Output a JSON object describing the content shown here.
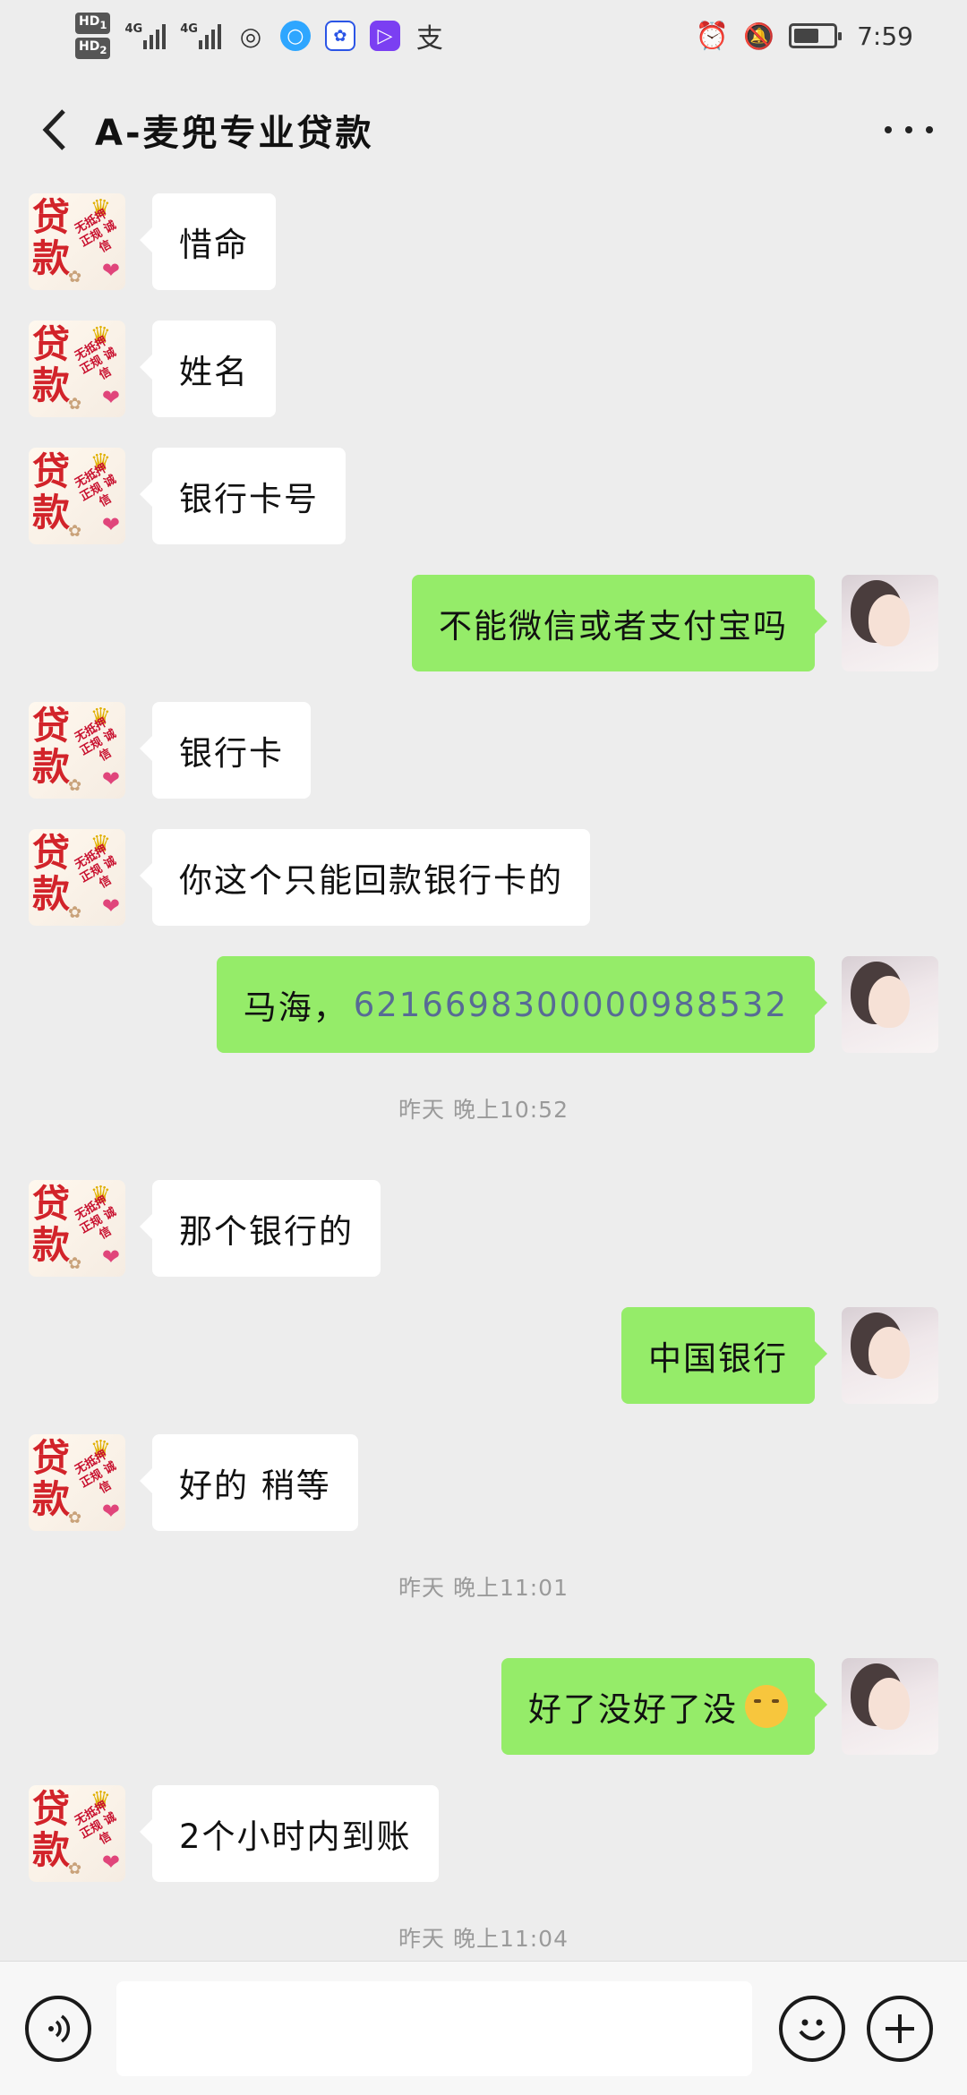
{
  "status_bar": {
    "hd_labels": [
      "HD",
      "HD"
    ],
    "hd_sub": [
      "1",
      "2"
    ],
    "network_labels": [
      "4G",
      "4G"
    ],
    "app_icons": [
      "weibo-icon",
      "browser-icon",
      "baidu-icon",
      "video-icon",
      "alipay-icon"
    ],
    "alipay_glyph": "支",
    "time": "7:59",
    "status_icons": [
      "alarm-icon",
      "mute-icon",
      "battery-icon"
    ],
    "battery_level": 0.65
  },
  "header": {
    "title": "A-麦兜专业贷款",
    "back_icon": "chevron-left-icon",
    "more_icon": "more-icon"
  },
  "contact_avatar": {
    "big_text": [
      "贷",
      "款"
    ],
    "small_text": "无抵押 正规 诚信"
  },
  "messages": [
    {
      "side": "left",
      "text": "惜命"
    },
    {
      "side": "left",
      "text": "姓名"
    },
    {
      "side": "left",
      "text": "银行卡号"
    },
    {
      "side": "right",
      "text": "不能微信或者支付宝吗"
    },
    {
      "side": "left",
      "text": "银行卡"
    },
    {
      "side": "left",
      "text": "你这个只能回款银行卡的"
    },
    {
      "side": "right",
      "text": "马海，",
      "link_text": "6216698300000988532"
    },
    {
      "timestamp": "昨天 晚上10:52"
    },
    {
      "side": "left",
      "text": "那个银行的"
    },
    {
      "side": "right",
      "text": "中国银行"
    },
    {
      "side": "left",
      "text": "好的 稍等"
    },
    {
      "timestamp": "昨天 晚上11:01"
    },
    {
      "side": "right",
      "text": "好了没好了没",
      "emoji": "thinking-face-emoji"
    },
    {
      "side": "left",
      "text": "2个小时内到账"
    },
    {
      "timestamp": "昨天 晚上11:04"
    }
  ],
  "input_bar": {
    "voice_icon": "voice-icon",
    "input_value": "",
    "emoji_icon": "emoji-icon",
    "plus_icon": "plus-icon"
  },
  "colors": {
    "chat_bg": "#ededed",
    "bubble_self": "#95ec69",
    "bubble_other": "#ffffff",
    "link": "#576b95"
  }
}
